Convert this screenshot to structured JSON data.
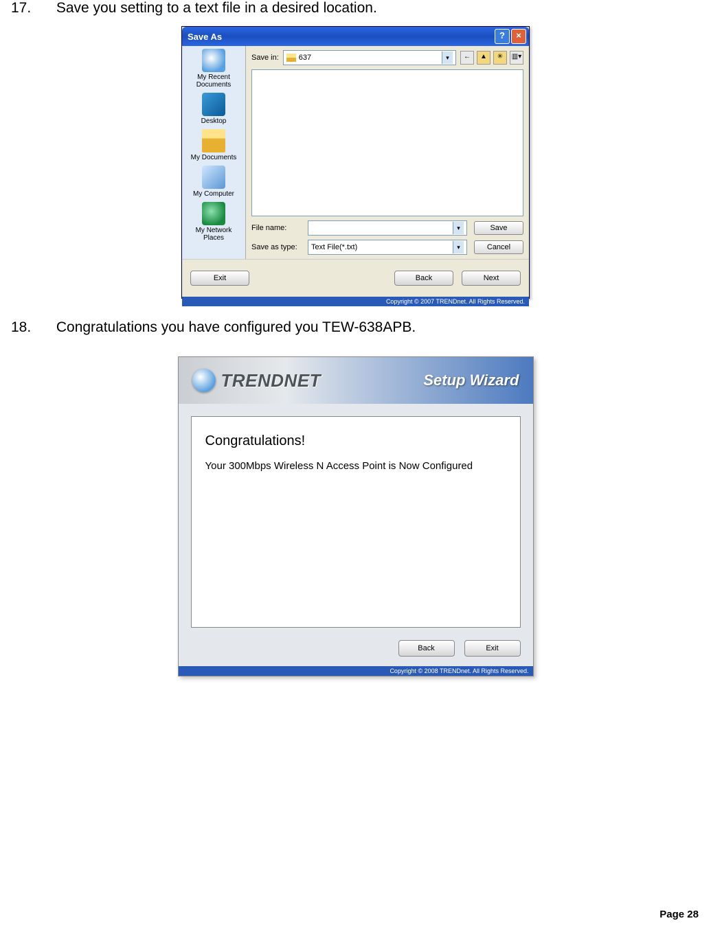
{
  "step17": {
    "number": "17.",
    "text": "Save you setting to a text file in a desired location."
  },
  "step18": {
    "number": "18.",
    "text": "Congratulations you have configured you TEW-638APB."
  },
  "saveAs": {
    "title": "Save As",
    "saveInLabel": "Save in:",
    "saveInValue": "637",
    "places": {
      "recent": "My Recent Documents",
      "desktop": "Desktop",
      "mydocs": "My Documents",
      "mycomp": "My Computer",
      "netplaces": "My Network Places"
    },
    "fileNameLabel": "File name:",
    "fileNameValue": "",
    "saveAsTypeLabel": "Save as type:",
    "saveAsTypeValue": "Text File(*.txt)",
    "saveBtn": "Save",
    "cancelBtn": "Cancel",
    "exitBtn": "Exit",
    "backBtn": "Back",
    "nextBtn": "Next",
    "copyright": "Copyright © 2007 TRENDnet. All Rights Reserved."
  },
  "wizard": {
    "brand": "TRENDNET",
    "title": "Setup Wizard",
    "heading": "Congratulations!",
    "body": "Your 300Mbps Wireless N Access Point is Now Configured",
    "backBtn": "Back",
    "exitBtn": "Exit",
    "copyright": "Copyright © 2008 TRENDnet. All Rights Reserved."
  },
  "pageNumber": "Page 28"
}
